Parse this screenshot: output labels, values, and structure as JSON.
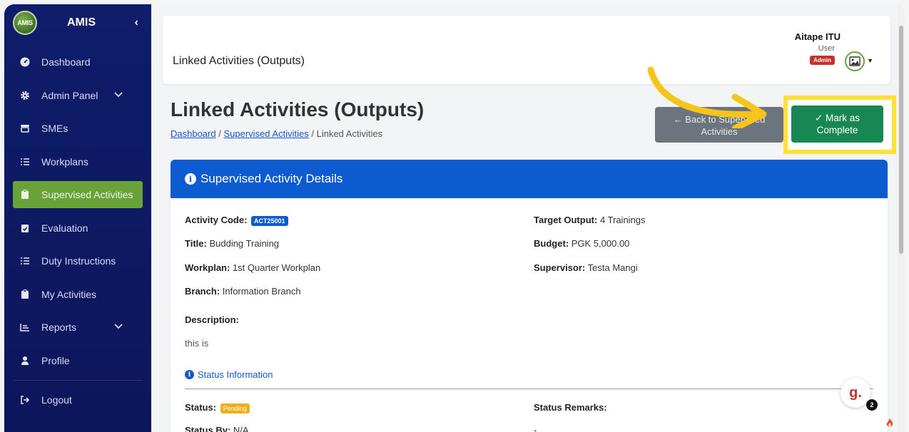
{
  "sidebar": {
    "logo_text": "AMIS",
    "title": "AMIS",
    "collapse_glyph": "‹",
    "items": [
      {
        "label": "Dashboard",
        "icon": "dashboard-icon"
      },
      {
        "label": "Admin Panel",
        "icon": "gear-icon",
        "has_submenu": true
      },
      {
        "label": "SMEs",
        "icon": "store-icon"
      },
      {
        "label": "Workplans",
        "icon": "list-icon"
      },
      {
        "label": "Supervised Activities",
        "icon": "clipboard-icon",
        "active": true
      },
      {
        "label": "Evaluation",
        "icon": "clipboard-check-icon"
      },
      {
        "label": "Duty Instructions",
        "icon": "list-icon"
      },
      {
        "label": "My Activities",
        "icon": "clipboard-icon"
      },
      {
        "label": "Reports",
        "icon": "chart-icon",
        "has_submenu": true
      },
      {
        "label": "Profile",
        "icon": "user-icon"
      },
      {
        "label": "Logout",
        "icon": "logout-icon"
      }
    ]
  },
  "topbar": {
    "title": "Linked Activities (Outputs)",
    "user_name": "Aitape ITU",
    "user_role": "User",
    "role_badge": "Admin"
  },
  "page": {
    "title": "Linked Activities (Outputs)",
    "breadcrumb": {
      "home": "Dashboard",
      "parent": "Supervised Activities",
      "current": "Linked Activities",
      "separator": "/"
    },
    "back_button": {
      "line1": "← Back to Supervised",
      "line2": "Activities"
    },
    "complete_button": {
      "line1": "✓ Mark as",
      "line2": "Complete"
    }
  },
  "details": {
    "header": "Supervised Activity Details",
    "activity_code_label": "Activity Code:",
    "activity_code": "ACT25001",
    "title_label": "Title:",
    "title": "Budding Training",
    "workplan_label": "Workplan:",
    "workplan": "1st Quarter Workplan",
    "branch_label": "Branch:",
    "branch": "Information Branch",
    "description_label": "Description:",
    "description": "this is",
    "target_output_label": "Target Output:",
    "target_output": "4 Trainings",
    "budget_label": "Budget:",
    "budget": "PGK 5,000.00",
    "supervisor_label": "Supervisor:",
    "supervisor": "Testa Mangi",
    "status_section": "Status Information",
    "status_label": "Status:",
    "status": "Pending",
    "status_remarks_label": "Status Remarks:",
    "status_remarks": "-",
    "status_by_label": "Status By:",
    "status_by": "N/A"
  },
  "widget": {
    "letter": "g.",
    "count": "2"
  },
  "colors": {
    "sidebar_bg": "#0f1d6b",
    "active_item": "#6aa23a",
    "card_header": "#0d5bd1",
    "complete_button": "#198754",
    "back_button": "#6c757d",
    "highlight": "#ffe13a",
    "admin_badge": "#c6302b",
    "pending_badge": "#f0ad1e"
  }
}
